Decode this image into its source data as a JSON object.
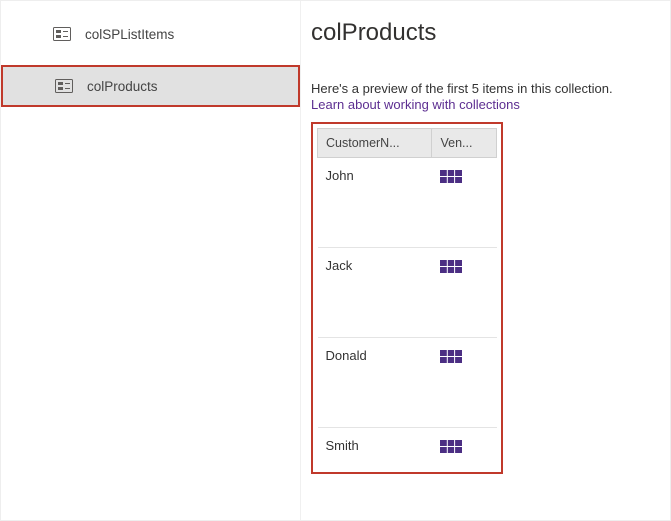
{
  "sidebar": {
    "items": [
      {
        "label": "colSPListItems",
        "selected": false
      },
      {
        "label": "colProducts",
        "selected": true
      }
    ]
  },
  "main": {
    "title": "colProducts",
    "subtitle": "Here's a preview of the first 5 items in this collection.",
    "link_text": "Learn about working with collections",
    "table": {
      "headers": [
        "CustomerN...",
        "Ven..."
      ],
      "rows": [
        {
          "customer": "John"
        },
        {
          "customer": "Jack"
        },
        {
          "customer": "Donald"
        },
        {
          "customer": "Smith"
        }
      ]
    }
  },
  "icons": {
    "collection_color": "#605e5c",
    "grid_color": "#4b2e83"
  }
}
